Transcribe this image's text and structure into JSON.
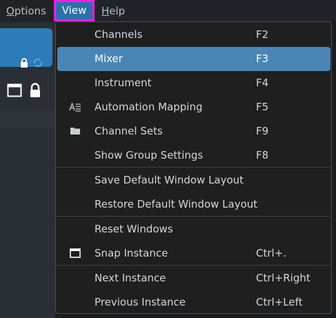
{
  "menubar": {
    "options": {
      "mnemonic": "O",
      "rest": "ptions"
    },
    "view": "View",
    "help": {
      "mnemonic": "H",
      "rest": "elp"
    }
  },
  "menu": {
    "items": [
      {
        "label": "Channels",
        "shortcut": "F2",
        "icon": ""
      },
      {
        "label": "Mixer",
        "shortcut": "F3",
        "icon": "",
        "highlighted": true
      },
      {
        "label": "Instrument",
        "shortcut": "F4",
        "icon": ""
      },
      {
        "label": "Automation Mapping",
        "shortcut": "F5",
        "icon": "automation-mapping-icon"
      },
      {
        "label": "Channel Sets",
        "shortcut": "F9",
        "icon": "folder-icon"
      },
      {
        "label": "Show Group Settings",
        "shortcut": "F8",
        "icon": ""
      },
      {
        "label": "Save Default Window Layout",
        "shortcut": "",
        "icon": ""
      },
      {
        "label": "Restore Default Window Layout",
        "shortcut": "",
        "icon": ""
      },
      {
        "label": "Reset Windows",
        "shortcut": "",
        "icon": ""
      },
      {
        "label": "Snap Instance",
        "shortcut": "Ctrl+.",
        "icon": "window-icon"
      },
      {
        "label": "Next Instance",
        "shortcut": "Ctrl+Right",
        "icon": ""
      },
      {
        "label": "Previous Instance",
        "shortcut": "Ctrl+Left",
        "icon": ""
      }
    ]
  },
  "colors": {
    "highlight": "#4a86b5",
    "view_outline": "#ff19e6",
    "accent": "#2d7bb8"
  }
}
